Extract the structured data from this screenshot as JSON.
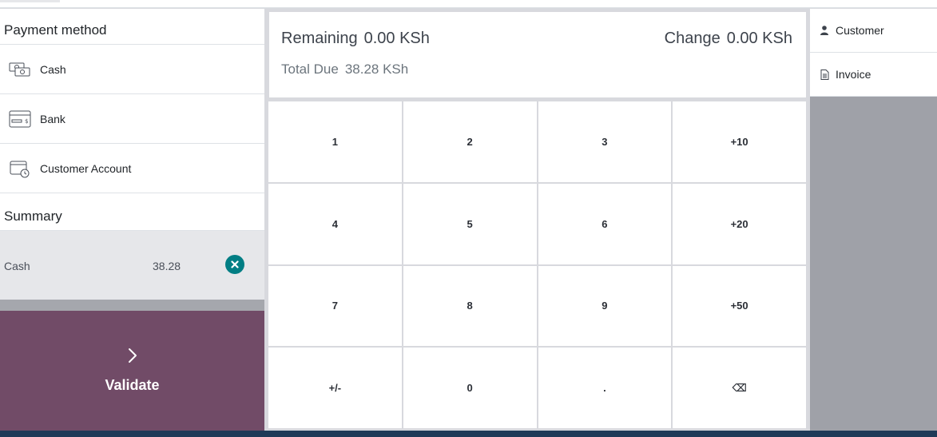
{
  "payment_methods": {
    "title": "Payment method",
    "items": [
      {
        "label": "Cash",
        "icon": "cash-icon"
      },
      {
        "label": "Bank",
        "icon": "bank-card-icon"
      },
      {
        "label": "Customer Account",
        "icon": "wallet-clock-icon"
      }
    ]
  },
  "summary": {
    "title": "Summary",
    "lines": [
      {
        "name": "Cash",
        "amount": "38.28",
        "remove_icon": "close-circle-icon"
      }
    ]
  },
  "validate": {
    "label": "Validate",
    "icon": "chevron-right-icon"
  },
  "status": {
    "remaining_label": "Remaining",
    "remaining_value": "0.00 KSh",
    "change_label": "Change",
    "change_value": "0.00 KSh",
    "total_due_label": "Total Due",
    "total_due_value": "38.28 KSh"
  },
  "numpad": {
    "keys": [
      "1",
      "2",
      "3",
      "+10",
      "4",
      "5",
      "6",
      "+20",
      "7",
      "8",
      "9",
      "+50",
      "+/-",
      "0",
      ".",
      "⌫"
    ]
  },
  "side_actions": {
    "customer_label": "Customer",
    "customer_icon": "user-icon",
    "invoice_label": "Invoice",
    "invoice_icon": "document-icon"
  },
  "colors": {
    "validate_bg": "#714b67",
    "remove_icon": "#017e84",
    "side_panel_bg": "#9fa1a8"
  }
}
